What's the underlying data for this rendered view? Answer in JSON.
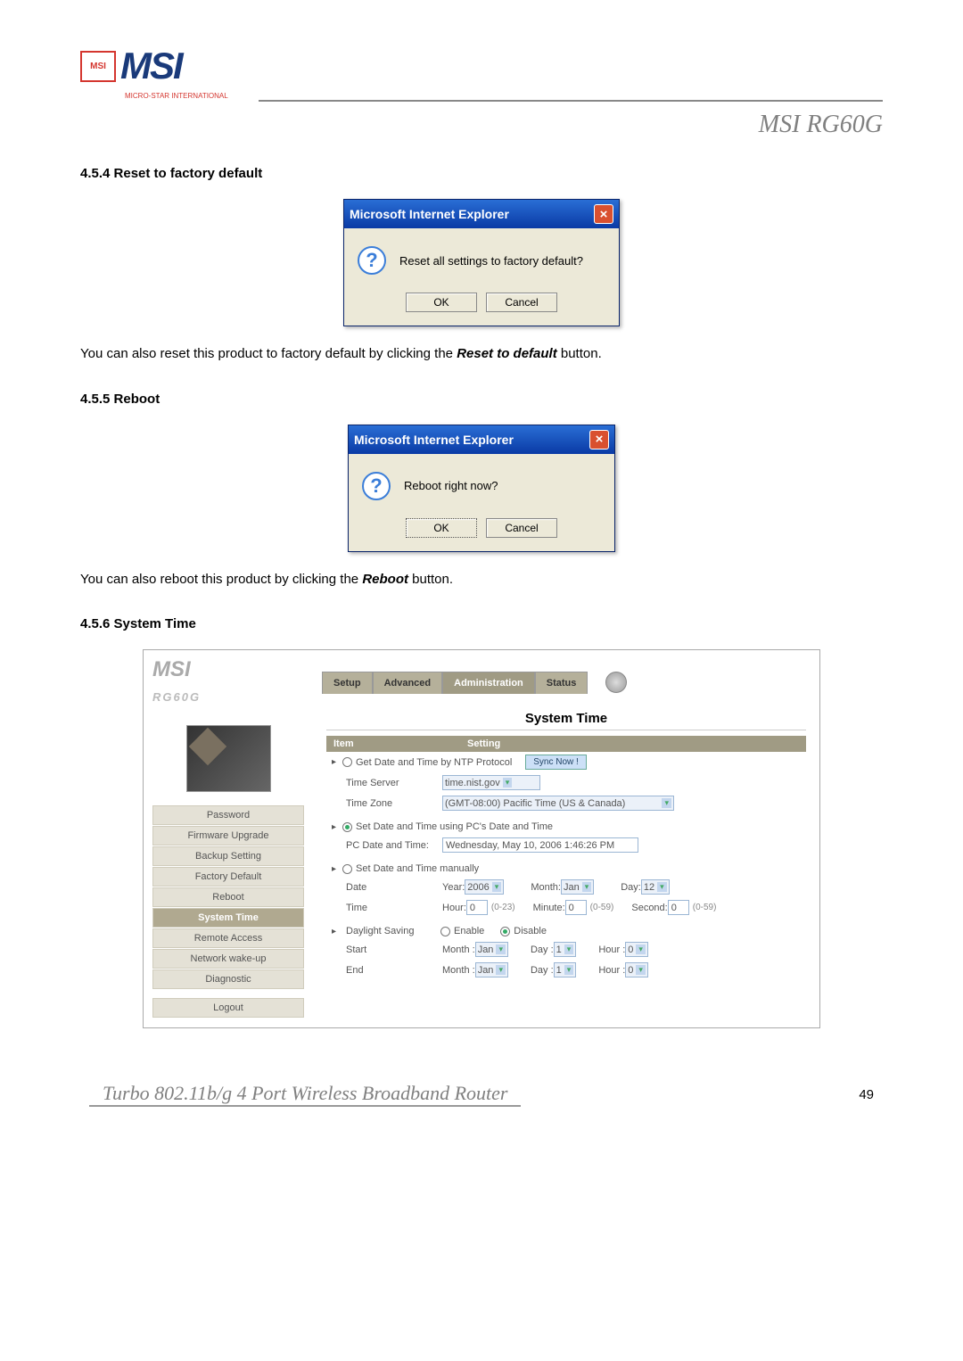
{
  "header": {
    "logo_text": "MSI",
    "logo_box": "MSI",
    "logo_sub": "MICRO-STAR INTERNATIONAL",
    "product": "MSI RG60G"
  },
  "sec1": {
    "title": "4.5.4 Reset to factory default",
    "dialog_title": "Microsoft Internet Explorer",
    "dialog_msg": "Reset all settings to factory default?",
    "ok": "OK",
    "cancel": "Cancel",
    "after": "You can also reset this product to factory default by clicking the ",
    "after_bold": "Reset to default",
    "after2": " button."
  },
  "sec2": {
    "title": "4.5.5 Reboot",
    "dialog_title": "Microsoft Internet Explorer",
    "dialog_msg": "Reboot right now?",
    "ok": "OK",
    "cancel": "Cancel",
    "after": "You can also reboot this product by clicking the ",
    "after_bold": "Reboot",
    "after2": " button."
  },
  "sec3": {
    "title": "4.5.6 System Time",
    "logo": "MSI",
    "model": "RG60G",
    "tabs": {
      "setup": "Setup",
      "advanced": "Advanced",
      "admin": "Administration",
      "status": "Status"
    },
    "nav": {
      "password": "Password",
      "firmware": "Firmware Upgrade",
      "backup": "Backup Setting",
      "factory": "Factory Default",
      "reboot": "Reboot",
      "systime": "System Time",
      "remote": "Remote Access",
      "wakeup": "Network wake-up",
      "diag": "Diagnostic",
      "logout": "Logout"
    },
    "panel_title": "System Time",
    "th_item": "Item",
    "th_setting": "Setting",
    "ntp_label": "Get Date and Time by NTP Protocol",
    "sync_btn": "Sync Now !",
    "timeserver_lbl": "Time Server",
    "timeserver_val": "time.nist.gov",
    "timezone_lbl": "Time Zone",
    "timezone_val": "(GMT-08:00) Pacific Time (US & Canada)",
    "pc_label": "Set Date and Time using PC's Date and Time",
    "pcdt_lbl": "PC Date and Time:",
    "pcdt_val": "Wednesday, May 10, 2006 1:46:26 PM",
    "manual_label": "Set Date and Time manually",
    "date_lbl": "Date",
    "year_lbl": "Year:",
    "year_val": "2006",
    "month_lbl": "Month:",
    "month_val": "Jan",
    "day_lbl": "Day:",
    "day_val": "12",
    "time_lbl": "Time",
    "hour_lbl": "Hour:",
    "hour_val": "0",
    "hour_hint": "(0-23)",
    "min_lbl": "Minute:",
    "min_val": "0",
    "min_hint": "(0-59)",
    "sec_lbl": "Second:",
    "sec_val": "0",
    "sec_hint": "(0-59)",
    "daylight_lbl": "Daylight Saving",
    "enable": "Enable",
    "disable": "Disable",
    "start_lbl": "Start",
    "end_lbl": "End",
    "s_month": "Month :",
    "s_month_v": "Jan",
    "s_day": "Day :",
    "s_day_v": "1",
    "s_hour": "Hour :",
    "s_hour_v": "0"
  },
  "footer": {
    "text": "Turbo 802.11b/g 4 Port Wireless Broadband Router",
    "page": "49"
  }
}
